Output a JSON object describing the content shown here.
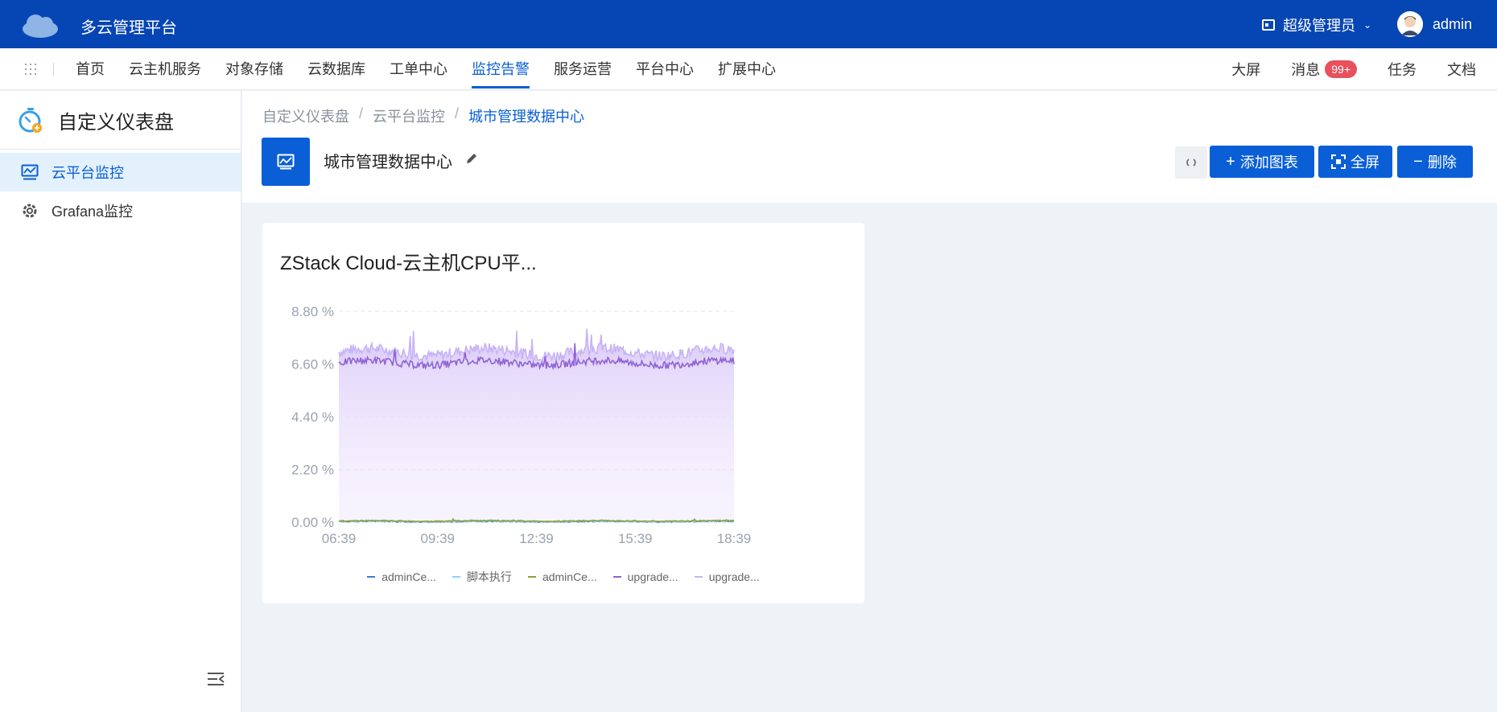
{
  "app": {
    "title": "多云管理平台",
    "role": "超级管理员",
    "user": "admin"
  },
  "nav": {
    "items": [
      "首页",
      "云主机服务",
      "对象存储",
      "云数据库",
      "工单中心",
      "监控告警",
      "服务运营",
      "平台中心",
      "扩展中心"
    ],
    "active_index": 5,
    "right": {
      "bigscreen": "大屏",
      "messages": "消息",
      "messages_badge": "99+",
      "tasks": "任务",
      "docs": "文档"
    }
  },
  "sidebar": {
    "title": "自定义仪表盘",
    "items": [
      {
        "label": "云平台监控",
        "icon": "monitor-chart-icon",
        "active": true
      },
      {
        "label": "Grafana监控",
        "icon": "grafana-icon",
        "active": false
      }
    ]
  },
  "breadcrumb": [
    "自定义仪表盘",
    "云平台监控",
    "城市管理数据中心"
  ],
  "dashboard": {
    "name": "城市管理数据中心"
  },
  "toolbar": {
    "add_chart": "添加图表",
    "fullscreen": "全屏",
    "delete": "删除"
  },
  "colors": {
    "primary": "#0a5fd6",
    "topbar": "#0645b4",
    "series_a": "#b99af0",
    "series_b": "#8f63d6"
  },
  "card": {
    "title": "ZStack Cloud-云主机CPU平..."
  },
  "chart_data": {
    "type": "area",
    "x_ticks": [
      "06:39",
      "09:39",
      "12:39",
      "15:39",
      "18:39"
    ],
    "y_ticks": [
      "0.00 %",
      "2.20 %",
      "4.40 %",
      "6.60 %",
      "8.80 %"
    ],
    "ylim": [
      0,
      8.8
    ],
    "grid": true,
    "legend_position": "bottom",
    "series": [
      {
        "name": "adminCe...",
        "color": "#3a7bd5",
        "baseline": 0.02
      },
      {
        "name": "脚本执行",
        "color": "#8fd3f0",
        "baseline": 0.03
      },
      {
        "name": "adminCe...",
        "color": "#8aa03a",
        "baseline": 0.05
      },
      {
        "name": "upgrade...",
        "color": "#8f63d6",
        "baseline": 6.65
      },
      {
        "name": "upgrade...",
        "color": "#c7b3f5",
        "baseline": 7.1
      }
    ]
  }
}
